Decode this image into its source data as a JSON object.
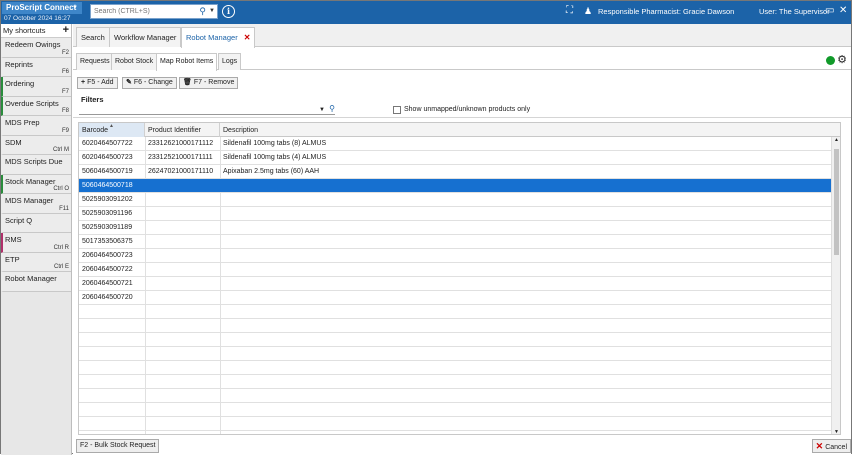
{
  "header": {
    "app_name": "ProScript Connect",
    "datetime": "07 October 2024 16:27",
    "search_placeholder": "Search (CTRL+S)",
    "pharmacist": "Responsible Pharmacist: Gracie Dawson",
    "user": "User: The Supervisor"
  },
  "sidebar": {
    "title": "My shortcuts",
    "items": [
      {
        "label": "Redeem Owings",
        "key": "F2"
      },
      {
        "label": "Reprints",
        "key": "F6"
      },
      {
        "label": "Ordering",
        "key": "F7"
      },
      {
        "label": "Overdue Scripts",
        "key": "F8"
      },
      {
        "label": "MDS Prep",
        "key": "F9"
      },
      {
        "label": "SDM",
        "key": "Ctrl M"
      },
      {
        "label": "MDS Scripts Due",
        "key": ""
      },
      {
        "label": "Stock Manager",
        "key": "Ctrl O"
      },
      {
        "label": "MDS Manager",
        "key": "F11"
      },
      {
        "label": "Script Q",
        "key": ""
      },
      {
        "label": "RMS",
        "key": "Ctrl R"
      },
      {
        "label": "ETP",
        "key": "Ctrl E"
      },
      {
        "label": "Robot Manager",
        "key": ""
      }
    ]
  },
  "tabs": [
    "Search",
    "Workflow Manager",
    "Robot Manager"
  ],
  "subtabs": [
    "Requests",
    "Robot Stock",
    "Map Robot Items",
    "Logs"
  ],
  "toolbar": {
    "add": "F5 - Add",
    "change": "F6 - Change",
    "remove": "F7 - Remove"
  },
  "filters": {
    "label": "Filters",
    "checkbox_label": "Show unmapped/unknown products only"
  },
  "grid": {
    "columns": [
      "Barcode",
      "Product Identifier",
      "Description"
    ],
    "rows": [
      {
        "barcode": "6020464507722",
        "pid": "23312621000171112",
        "desc": "Sildenafil 100mg tabs (8) ALMUS"
      },
      {
        "barcode": "6020464500723",
        "pid": "23312521000171111",
        "desc": "Sildenafil 100mg tabs (4) ALMUS"
      },
      {
        "barcode": "5060464500719",
        "pid": "26247021000171110",
        "desc": "Apixaban 2.5mg tabs (60) AAH"
      },
      {
        "barcode": "5060464500718",
        "pid": "",
        "desc": ""
      },
      {
        "barcode": "5025903091202",
        "pid": "",
        "desc": ""
      },
      {
        "barcode": "5025903091196",
        "pid": "",
        "desc": ""
      },
      {
        "barcode": "5025903091189",
        "pid": "",
        "desc": ""
      },
      {
        "barcode": "5017353506375",
        "pid": "",
        "desc": ""
      },
      {
        "barcode": "2060464500723",
        "pid": "",
        "desc": ""
      },
      {
        "barcode": "2060464500722",
        "pid": "",
        "desc": ""
      },
      {
        "barcode": "2060464500721",
        "pid": "",
        "desc": ""
      },
      {
        "barcode": "2060464500720",
        "pid": "",
        "desc": ""
      }
    ]
  },
  "footer": {
    "bulk": "F2 - Bulk Stock Request",
    "cancel": "Cancel"
  },
  "colors": {
    "brand": "#1c63a8",
    "selected_row": "#1670d0",
    "status_ok": "#119a2a",
    "close_red": "#cc0000"
  }
}
